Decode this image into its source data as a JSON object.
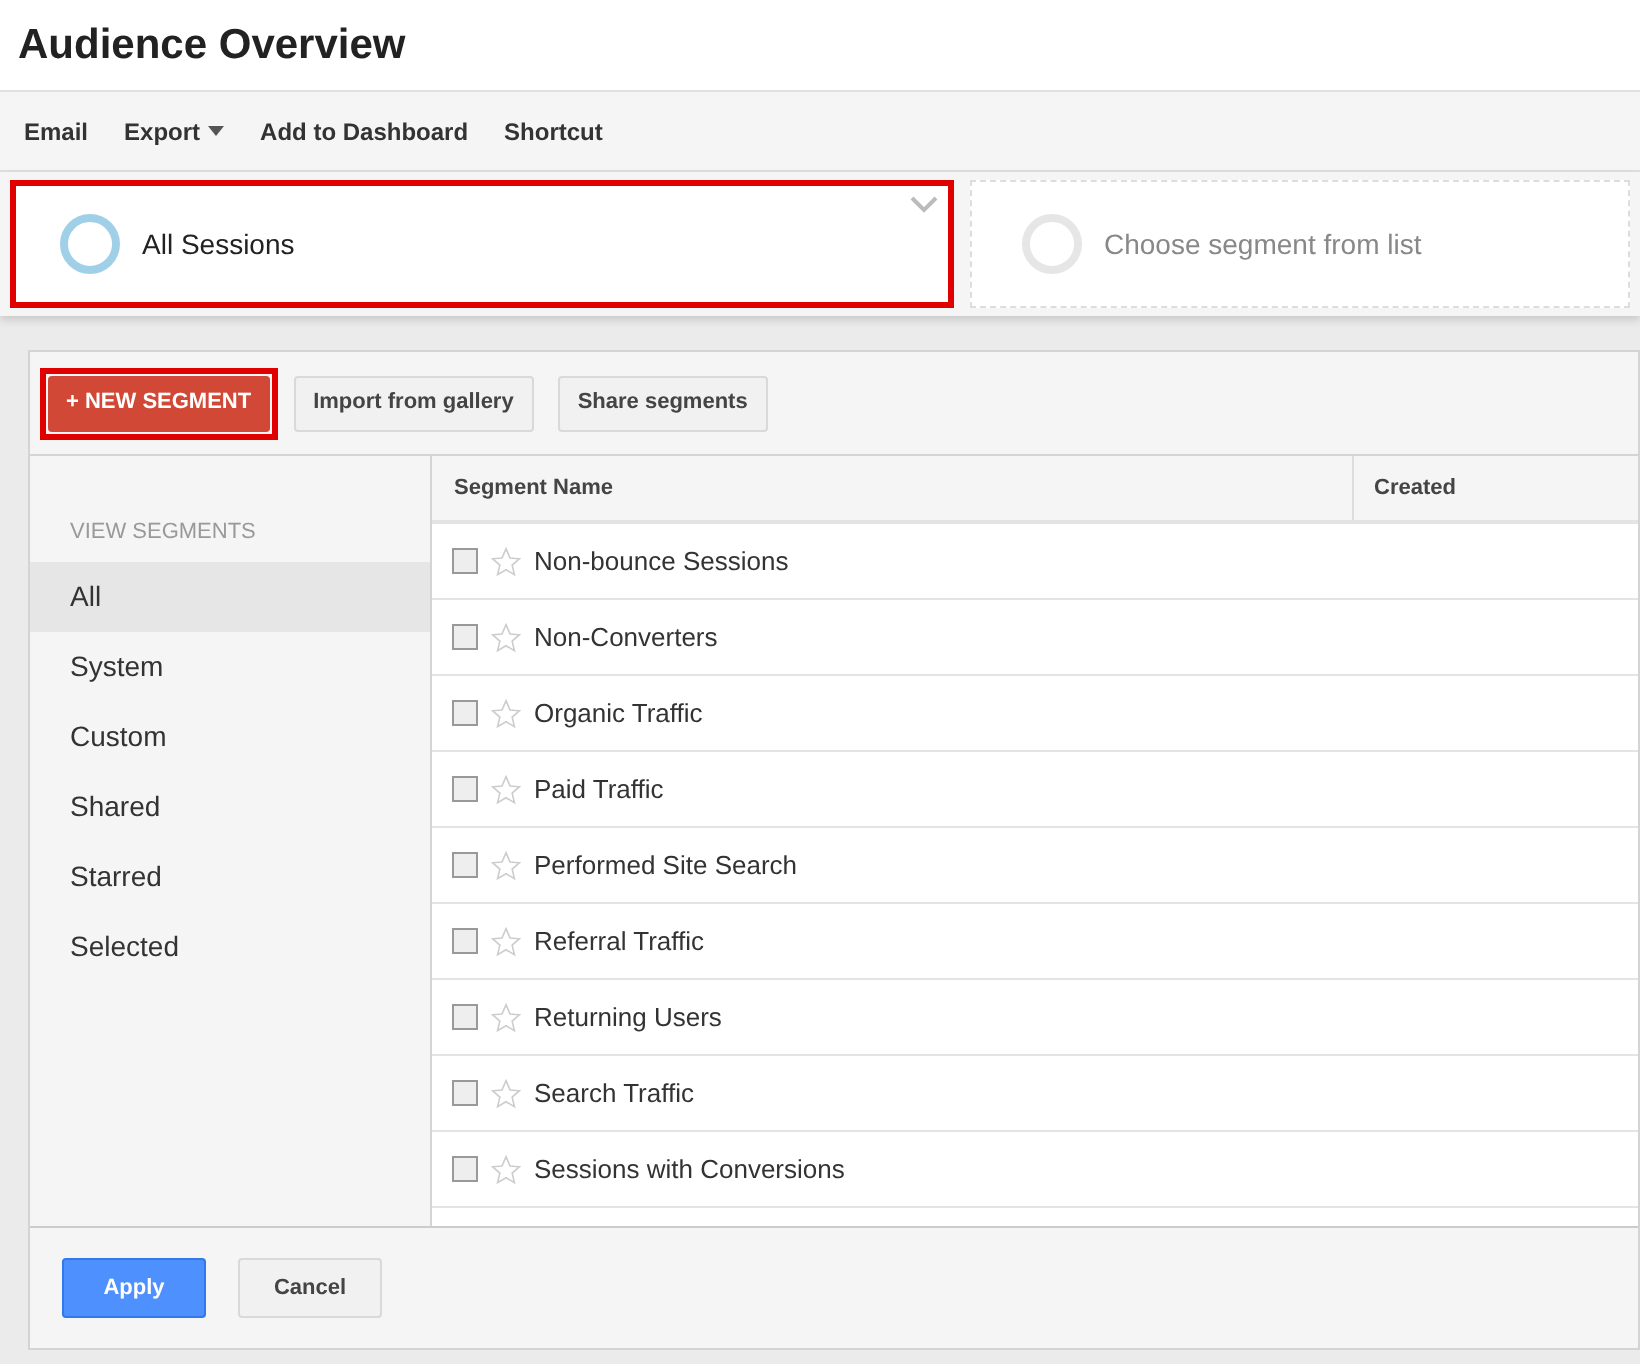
{
  "title": "Audience Overview",
  "toolbar": [
    {
      "label": "Email",
      "kind": "link"
    },
    {
      "label": "Export",
      "kind": "dropdown"
    },
    {
      "label": "Add to Dashboard",
      "kind": "link"
    },
    {
      "label": "Shortcut",
      "kind": "link"
    }
  ],
  "segments": [
    {
      "label": "All Sessions",
      "kind": "active",
      "highlighted": true
    },
    {
      "label": "Choose segment from list",
      "kind": "empty",
      "highlighted": false
    }
  ],
  "actions": [
    {
      "label": "+ NEW SEGMENT",
      "kind": "primary",
      "highlighted": true
    },
    {
      "label": "Import from gallery",
      "kind": "secondary",
      "highlighted": false
    },
    {
      "label": "Share segments",
      "kind": "secondary",
      "highlighted": false
    }
  ],
  "sidebar": {
    "heading": "VIEW SEGMENTS",
    "items": [
      {
        "label": "All",
        "selected": true
      },
      {
        "label": "System",
        "selected": false
      },
      {
        "label": "Custom",
        "selected": false
      },
      {
        "label": "Shared",
        "selected": false
      },
      {
        "label": "Starred",
        "selected": false
      },
      {
        "label": "Selected",
        "selected": false
      }
    ]
  },
  "table": {
    "columns": [
      "Segment Name",
      "Created"
    ],
    "rows": [
      {
        "name": "Non-bounce Sessions",
        "checked": false,
        "starred": false
      },
      {
        "name": "Non-Converters",
        "checked": false,
        "starred": false
      },
      {
        "name": "Organic Traffic",
        "checked": false,
        "starred": false
      },
      {
        "name": "Paid Traffic",
        "checked": false,
        "starred": false
      },
      {
        "name": "Performed Site Search",
        "checked": false,
        "starred": false
      },
      {
        "name": "Referral Traffic",
        "checked": false,
        "starred": false
      },
      {
        "name": "Returning Users",
        "checked": false,
        "starred": false
      },
      {
        "name": "Search Traffic",
        "checked": false,
        "starred": false
      },
      {
        "name": "Sessions with Conversions",
        "checked": false,
        "starred": false
      }
    ]
  },
  "footer": [
    {
      "label": "Apply",
      "kind": "primary"
    },
    {
      "label": "Cancel",
      "kind": "secondary"
    }
  ]
}
